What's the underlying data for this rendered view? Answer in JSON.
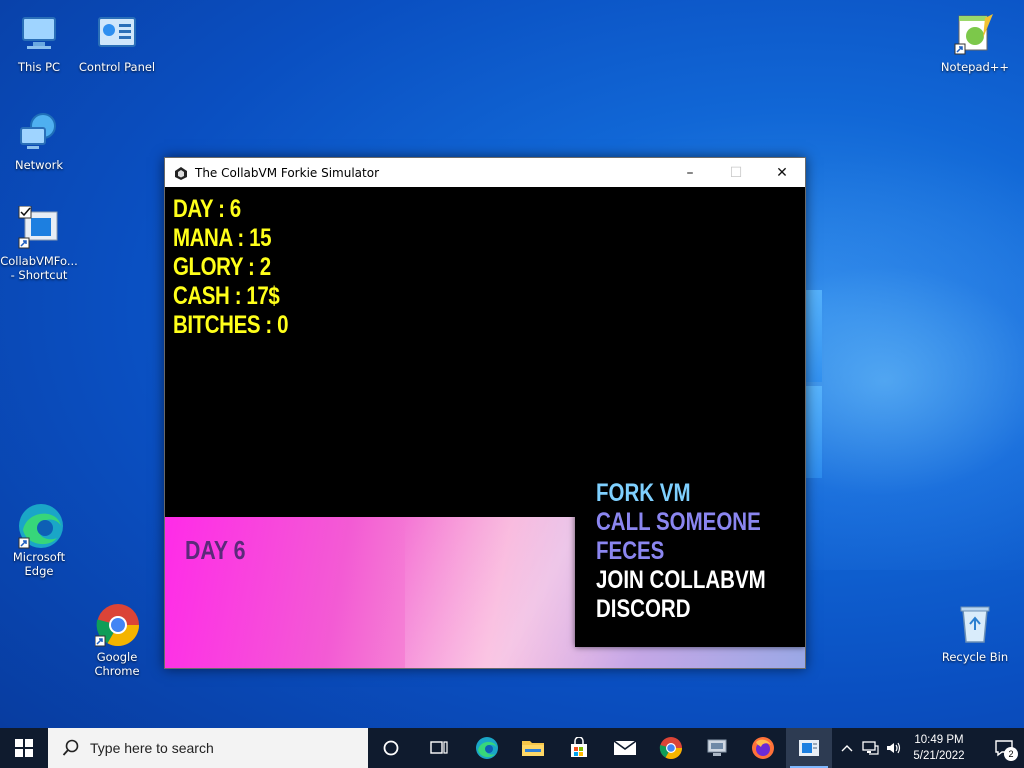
{
  "desktop": {
    "icons": [
      {
        "label": "This PC"
      },
      {
        "label": "Control Panel"
      },
      {
        "label": "Network"
      },
      {
        "label": "CollabVMFo... - Shortcut"
      },
      {
        "label": "Microsoft Edge"
      },
      {
        "label": "Google Chrome"
      },
      {
        "label": "Notepad++"
      },
      {
        "label": "Recycle Bin"
      }
    ]
  },
  "window": {
    "title": "The CollabVM Forkie Simulator",
    "minimize": "–",
    "maximize": "☐",
    "close": "✕"
  },
  "game": {
    "stats": [
      {
        "text": "DAY : 6"
      },
      {
        "text": "MANA : 15"
      },
      {
        "text": "GLORY : 2"
      },
      {
        "text": "CASH : 17$"
      },
      {
        "text": "BITCHES : 0"
      }
    ],
    "day_label": "DAY 6",
    "menu": [
      {
        "text": "FORK VM",
        "color": "#7fd0ff"
      },
      {
        "text": "CALL SOMEONE",
        "color": "#8b86f0"
      },
      {
        "text": "FECES",
        "color": "#8b86f0"
      },
      {
        "text": "JOIN COLLABVM",
        "color": "#ffffff"
      },
      {
        "text": "DISCORD",
        "color": "#ffffff"
      }
    ],
    "stat_color": "#ffff1a"
  },
  "taskbar": {
    "search_placeholder": "Type here to search",
    "clock_time": "10:49 PM",
    "clock_date": "5/21/2022",
    "notification_count": "2"
  }
}
